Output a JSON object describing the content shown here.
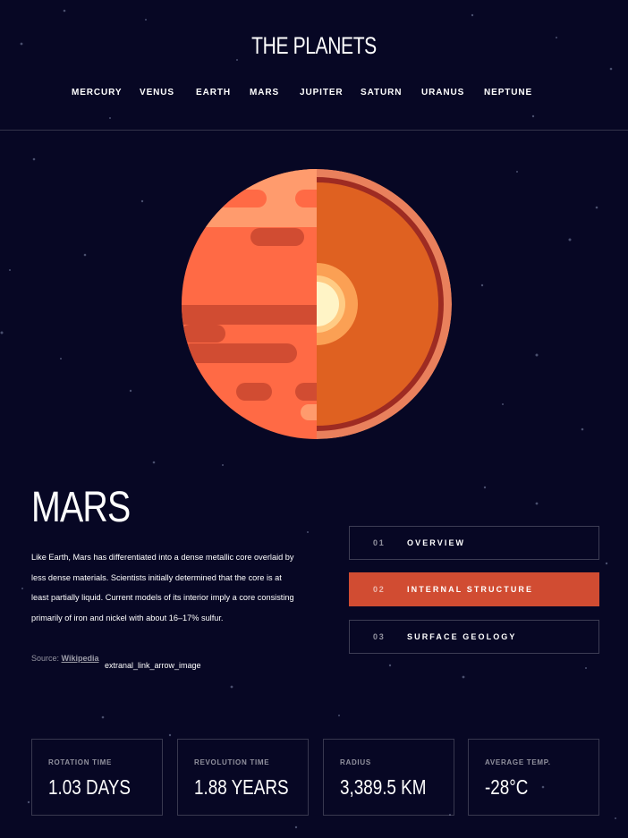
{
  "header": {
    "logo": "THE PLANETS",
    "nav": [
      "MERCURY",
      "VENUS",
      "EARTH",
      "MARS",
      "JUPITER",
      "SATURN",
      "URANUS",
      "NEPTUNE"
    ]
  },
  "planet": {
    "name": "MARS",
    "description": "Like Earth, Mars has differentiated into a dense metallic core overlaid by less dense materials. Scientists initially determined that the core is at least partially liquid. Current models of its interior imply a core consisting primarily of iron and nickel with about 16–17% sulfur.",
    "source_label": "Source:",
    "source_link": "Wikipedia",
    "source_image_alt": "extranal_link_arrow_image"
  },
  "tabs": [
    {
      "num": "01",
      "label": "OVERVIEW"
    },
    {
      "num": "02",
      "label": "INTERNAL STRUCTURE"
    },
    {
      "num": "03",
      "label": "SURFACE GEOLOGY"
    }
  ],
  "stats": [
    {
      "label": "ROTATION TIME",
      "value": "1.03 DAYS"
    },
    {
      "label": "REVOLUTION TIME",
      "value": "1.88 YEARS"
    },
    {
      "label": "RADIUS",
      "value": "3,389.5 KM"
    },
    {
      "label": "AVERAGE TEMP.",
      "value": "-28°C"
    }
  ],
  "colors": {
    "background": "#070724",
    "accent": "#D14C32"
  }
}
